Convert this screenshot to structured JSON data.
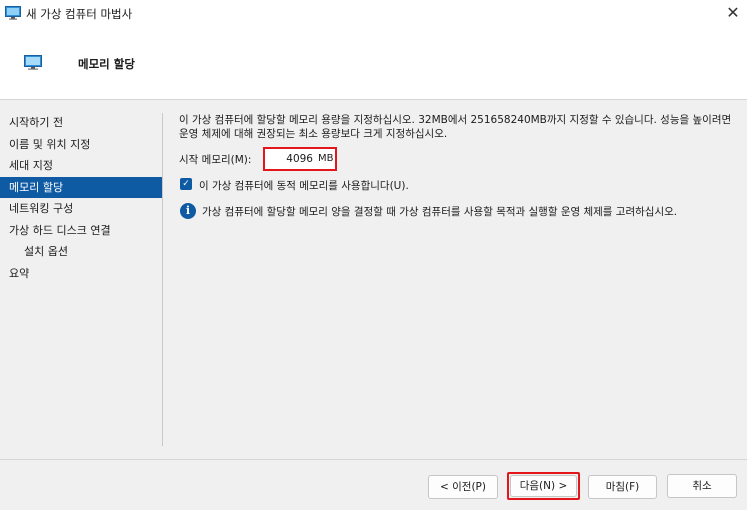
{
  "window": {
    "title": "새 가상 컴퓨터 마법사",
    "icon": "monitor-icon",
    "close_glyph": "✕"
  },
  "header": {
    "title": "메모리 할당",
    "icon": "monitor-icon"
  },
  "nav": {
    "items": [
      {
        "label": "시작하기 전",
        "active": false,
        "sub": false
      },
      {
        "label": "이름 및 위치 지정",
        "active": false,
        "sub": false
      },
      {
        "label": "세대 지정",
        "active": false,
        "sub": false
      },
      {
        "label": "메모리 할당",
        "active": true,
        "sub": false
      },
      {
        "label": "네트워킹 구성",
        "active": false,
        "sub": false
      },
      {
        "label": "가상 하드 디스크 연결",
        "active": false,
        "sub": false
      },
      {
        "label": "설치 옵션",
        "active": false,
        "sub": true
      },
      {
        "label": "요약",
        "active": false,
        "sub": false
      }
    ]
  },
  "main": {
    "description": "이 가상 컴퓨터에 할당할 메모리 용량을 지정하십시오. 32MB에서 251658240MB까지 지정할 수 있습니다. 성능을 높이려면 운영 체제에 대해 권장되는 최소 용량보다 크게 지정하십시오.",
    "startup_memory": {
      "label": "시작 메모리(M):",
      "value": "4096",
      "unit": "MB"
    },
    "dynamic_memory": {
      "label": "이 가상 컴퓨터에 동적 메모리를 사용합니다(U).",
      "checked": true
    },
    "info_text": "가상 컴퓨터에 할당할 메모리 양을 결정할 때 가상 컴퓨터를 사용할 목적과 실행할 운영 체제를 고려하십시오."
  },
  "buttons": {
    "prev": "< 이전(P)",
    "next": "다음(N) >",
    "finish": "마침(F)",
    "cancel": "취소"
  },
  "colors": {
    "accent": "#0e5aa3",
    "highlight": "#e2161b"
  }
}
